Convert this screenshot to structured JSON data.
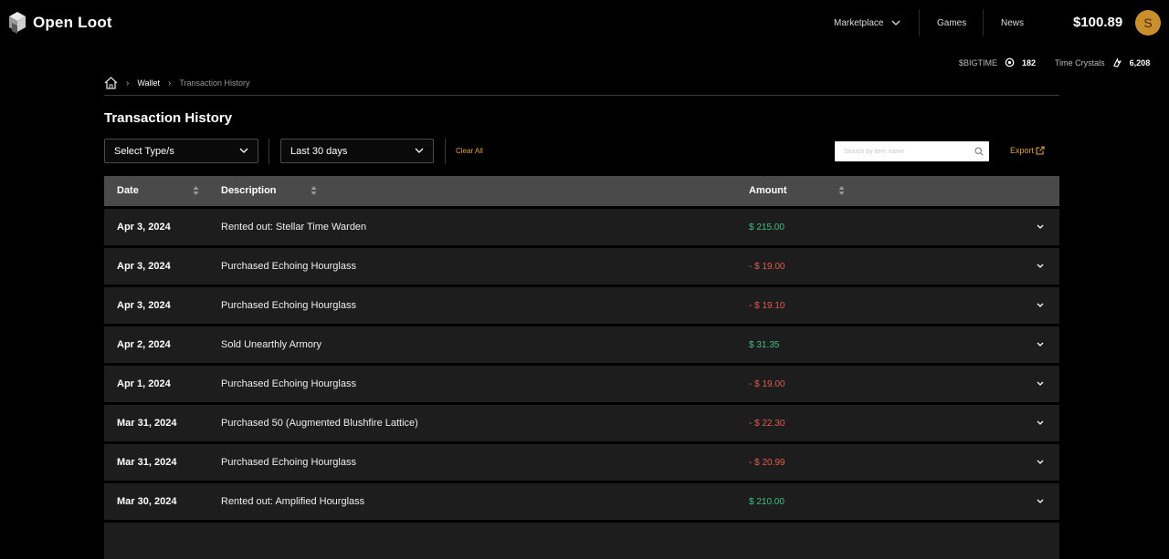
{
  "brand": {
    "name": "Open Loot"
  },
  "nav": {
    "marketplace": "Marketplace",
    "games": "Games",
    "news": "News",
    "balance": "$100.89",
    "avatar_letter": "S"
  },
  "currencies": [
    {
      "label": "$BIGTIME",
      "value": "182"
    },
    {
      "label": "Time Crystals",
      "value": "6,208"
    }
  ],
  "breadcrumb": {
    "wallet": "Wallet",
    "current": "Transaction History"
  },
  "page": {
    "title": "Transaction History"
  },
  "filters": {
    "type_select": "Select Type/s",
    "date_select": "Last 30 days",
    "clear_all": "Clear All",
    "search_placeholder": "Search by item name",
    "export": "Export"
  },
  "table": {
    "headers": {
      "date": "Date",
      "description": "Description",
      "amount": "Amount"
    },
    "rows": [
      {
        "date": "Apr 3, 2024",
        "description": "Rented out: Stellar Time Warden",
        "amount": "$ 215.00",
        "direction": "in"
      },
      {
        "date": "Apr 3, 2024",
        "description": "Purchased Echoing Hourglass",
        "amount": "- $ 19.00",
        "direction": "out"
      },
      {
        "date": "Apr 3, 2024",
        "description": "Purchased Echoing Hourglass",
        "amount": "- $ 19.10",
        "direction": "out"
      },
      {
        "date": "Apr 2, 2024",
        "description": "Sold Unearthly Armory",
        "amount": "$ 31.35",
        "direction": "in"
      },
      {
        "date": "Apr 1, 2024",
        "description": "Purchased Echoing Hourglass",
        "amount": "- $ 19.00",
        "direction": "out"
      },
      {
        "date": "Mar 31, 2024",
        "description": "Purchased 50 (Augmented Blushfire Lattice)",
        "amount": "- $ 22.30",
        "direction": "out"
      },
      {
        "date": "Mar 31, 2024",
        "description": "Purchased Echoing Hourglass",
        "amount": "- $ 20.99",
        "direction": "out"
      },
      {
        "date": "Mar 30, 2024",
        "description": "Rented out: Amplified Hourglass",
        "amount": "$ 210.00",
        "direction": "in"
      }
    ]
  },
  "colors": {
    "accent": "#e3a43c",
    "positive": "#3fbf86",
    "negative": "#e25a4c",
    "header_bg": "#4a4a4a",
    "row_bg": "#1d1d1d"
  }
}
